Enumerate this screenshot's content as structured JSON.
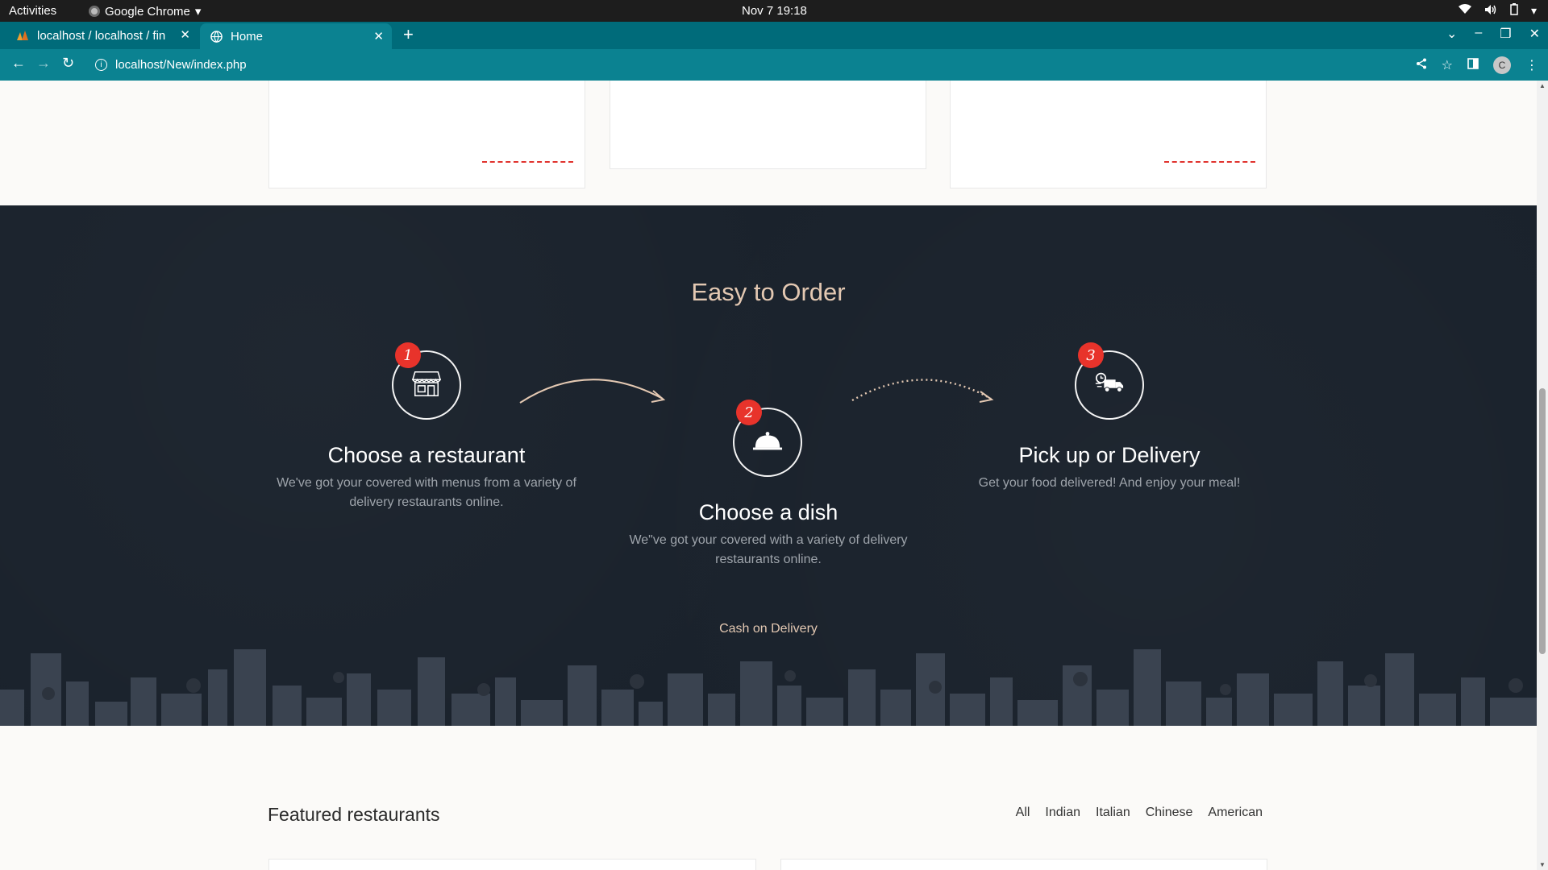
{
  "system_bar": {
    "activities": "Activities",
    "app_name": "Google Chrome",
    "clock": "Nov 7  19:18"
  },
  "browser": {
    "tabs": [
      {
        "title": "localhost / localhost / fin",
        "active": false
      },
      {
        "title": "Home",
        "active": true
      }
    ],
    "url": "localhost/New/index.php",
    "profile_initial": "C"
  },
  "how_it_works": {
    "title": "Easy to Order",
    "steps": [
      {
        "number": "1",
        "icon": "storefront-icon",
        "title": "Choose a restaurant",
        "description": "We've got your covered with menus from a variety of delivery restaurants online."
      },
      {
        "number": "2",
        "icon": "cloche-icon",
        "title": "Choose a dish",
        "description": "We\"ve got your covered with a variety of delivery restaurants online."
      },
      {
        "number": "3",
        "icon": "delivery-truck-icon",
        "title": "Pick up or Delivery",
        "description": "Get your food delivered! And enjoy your meal!"
      }
    ],
    "footer_note": "Cash on Delivery"
  },
  "featured": {
    "title": "Featured restaurants",
    "filters": [
      "All",
      "Indian",
      "Italian",
      "Chinese",
      "American"
    ]
  },
  "colors": {
    "chrome_tab_strip": "#006b7a",
    "chrome_toolbar": "#0b8291",
    "dark_section": "#1a222c",
    "accent_title": "#e3c8b2",
    "badge_red": "#e8332b"
  }
}
